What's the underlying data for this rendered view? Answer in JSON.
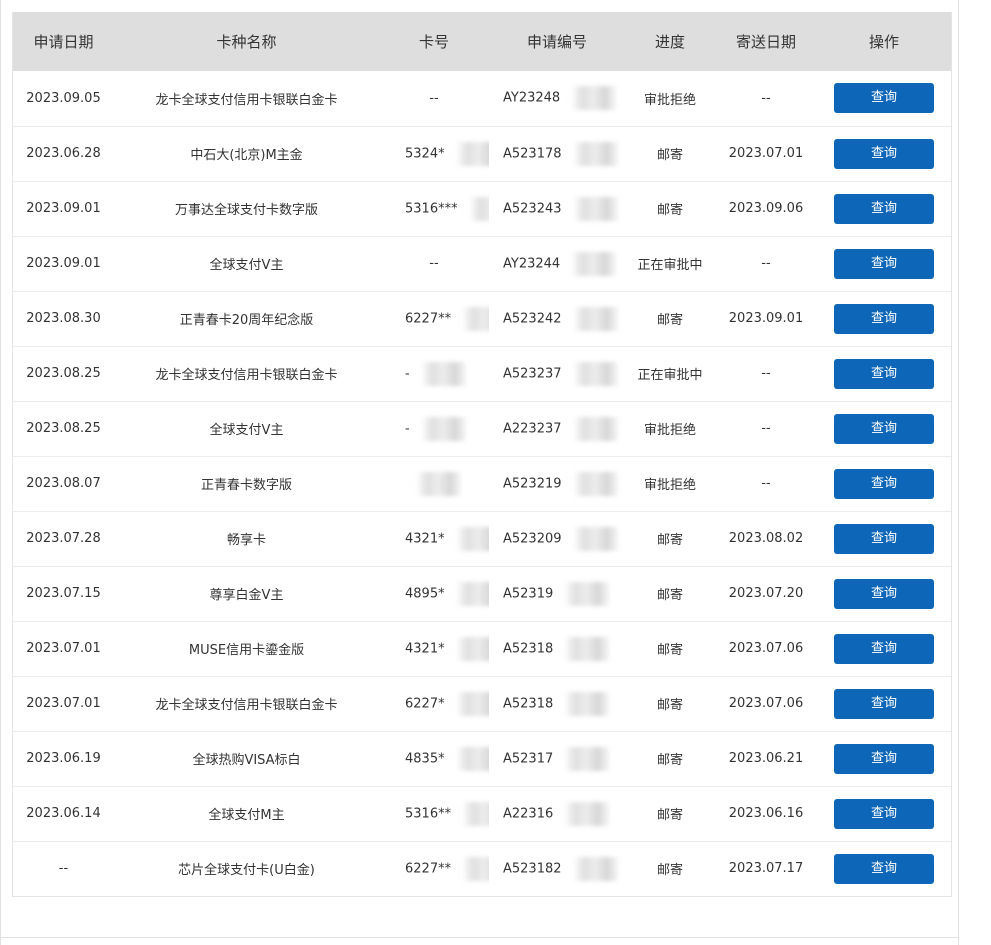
{
  "columns": [
    "申请日期",
    "卡种名称",
    "卡号",
    "申请编号",
    "进度",
    "寄送日期",
    "操作"
  ],
  "rows": [
    {
      "apply_date": "2023.09.05",
      "card_name": "龙卡全球支付信用卡银联白金卡",
      "card_no": "--",
      "apply_no": "AY23248",
      "progress": "审批拒绝",
      "send_date": "--",
      "action": "查询"
    },
    {
      "apply_date": "2023.06.28",
      "card_name": "中石大(北京)M主金",
      "card_no": "5324*",
      "apply_no": "A523178",
      "progress": "邮寄",
      "send_date": "2023.07.01",
      "action": "查询"
    },
    {
      "apply_date": "2023.09.01",
      "card_name": "万事达全球支付卡数字版",
      "card_no": "5316***",
      "apply_no": "A523243",
      "progress": "邮寄",
      "send_date": "2023.09.06",
      "action": "查询"
    },
    {
      "apply_date": "2023.09.01",
      "card_name": "全球支付V主",
      "card_no": "--",
      "apply_no": "AY23244",
      "progress": "正在审批中",
      "send_date": "--",
      "action": "查询"
    },
    {
      "apply_date": "2023.08.30",
      "card_name": "正青春卡20周年纪念版",
      "card_no": "6227**",
      "apply_no": "A523242",
      "progress": "邮寄",
      "send_date": "2023.09.01",
      "action": "查询"
    },
    {
      "apply_date": "2023.08.25",
      "card_name": "龙卡全球支付信用卡银联白金卡",
      "card_no": "-",
      "apply_no": "A523237",
      "progress": "正在审批中",
      "send_date": "--",
      "action": "查询"
    },
    {
      "apply_date": "2023.08.25",
      "card_name": "全球支付V主",
      "card_no": "-",
      "apply_no": "A223237",
      "progress": "审批拒绝",
      "send_date": "--",
      "action": "查询"
    },
    {
      "apply_date": "2023.08.07",
      "card_name": "正青春卡数字版",
      "card_no": "",
      "apply_no": "A523219",
      "progress": "审批拒绝",
      "send_date": "--",
      "action": "查询"
    },
    {
      "apply_date": "2023.07.28",
      "card_name": "畅享卡",
      "card_no": "4321*",
      "apply_no": "A523209",
      "progress": "邮寄",
      "send_date": "2023.08.02",
      "action": "查询"
    },
    {
      "apply_date": "2023.07.15",
      "card_name": "尊享白金V主",
      "card_no": "4895*",
      "apply_no": "A52319",
      "progress": "邮寄",
      "send_date": "2023.07.20",
      "action": "查询"
    },
    {
      "apply_date": "2023.07.01",
      "card_name": "MUSE信用卡鎏金版",
      "card_no": "4321*",
      "apply_no": "A52318",
      "progress": "邮寄",
      "send_date": "2023.07.06",
      "action": "查询"
    },
    {
      "apply_date": "2023.07.01",
      "card_name": "龙卡全球支付信用卡银联白金卡",
      "card_no": "6227*",
      "apply_no": "A52318",
      "progress": "邮寄",
      "send_date": "2023.07.06",
      "action": "查询"
    },
    {
      "apply_date": "2023.06.19",
      "card_name": "全球热购VISA标白",
      "card_no": "4835*",
      "apply_no": "A52317",
      "progress": "邮寄",
      "send_date": "2023.06.21",
      "action": "查询"
    },
    {
      "apply_date": "2023.06.14",
      "card_name": "全球支付M主",
      "card_no": "5316**",
      "apply_no": "A22316",
      "progress": "邮寄",
      "send_date": "2023.06.16",
      "action": "查询"
    },
    {
      "apply_date": "--",
      "card_name": "芯片全球支付卡(U白金)",
      "card_no": "6227**",
      "apply_no": "A523182",
      "progress": "邮寄",
      "send_date": "2023.07.17",
      "action": "查询"
    }
  ],
  "colors": {
    "header_bg": "#dedede",
    "button_bg": "#0d66b7",
    "button_text": "#ffffff"
  }
}
